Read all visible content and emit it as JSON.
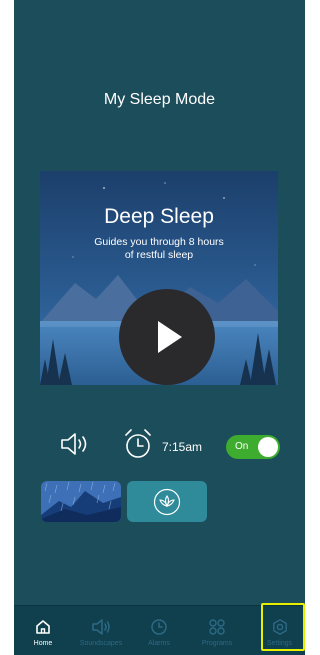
{
  "header": {
    "title": "My Sleep Mode"
  },
  "hero": {
    "title": "Deep Sleep",
    "subtitle": "Guides you through 8 hours of restful sleep"
  },
  "controls": {
    "alarm_time": "7:15am",
    "toggle_label": "On",
    "toggle_state": "on"
  },
  "sound_tiles": [
    {
      "icon": "mountain-rain"
    },
    {
      "icon": "lotus-icon"
    }
  ],
  "nav": {
    "items": [
      {
        "label": "Home",
        "icon": "home-icon",
        "active": true
      },
      {
        "label": "Soundscapes",
        "icon": "speaker-icon",
        "active": false
      },
      {
        "label": "Alarms",
        "icon": "clock-icon",
        "active": false
      },
      {
        "label": "Programs",
        "icon": "grid-icon",
        "active": false
      },
      {
        "label": "Settings",
        "icon": "gear-icon",
        "active": false
      }
    ]
  },
  "colors": {
    "background": "#1c4d5a",
    "navbar": "#103f4d",
    "toggle_on": "#3eac2f",
    "nav_inactive": "#2c6a86",
    "highlight": "#e8f000"
  }
}
